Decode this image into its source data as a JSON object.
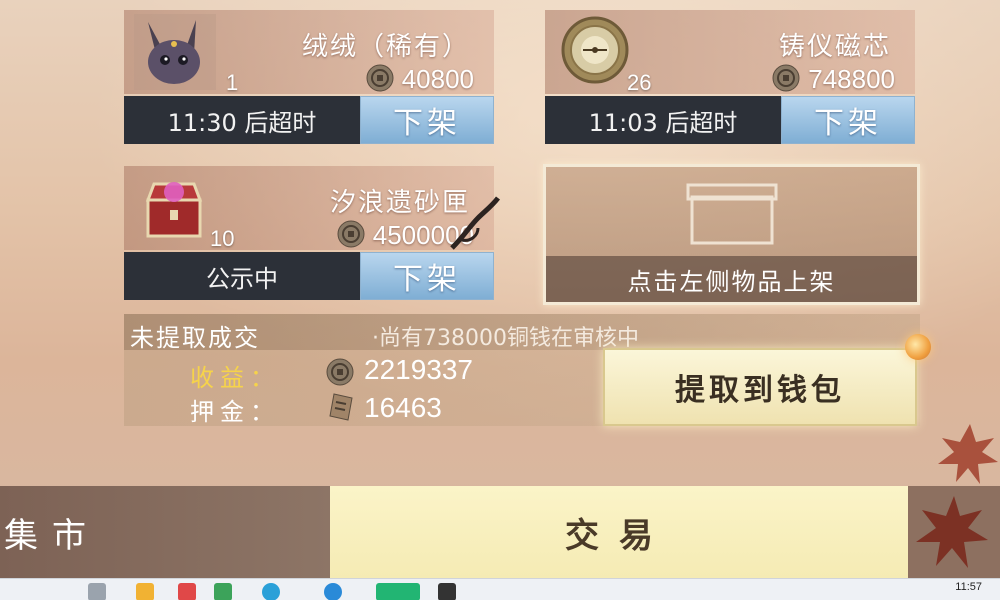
{
  "listings": [
    {
      "name": "绒绒（稀有）",
      "quantity": "1",
      "price": "40800",
      "status": "11:30 后超时",
      "action": "下架",
      "icon": "purple-creature-icon"
    },
    {
      "name": "铸仪磁芯",
      "quantity": "26",
      "price": "748800",
      "status": "11:03 后超时",
      "action": "下架",
      "icon": "compass-core-icon"
    },
    {
      "name": "汐浪遗砂匣",
      "quantity": "10",
      "price": "4500000",
      "status": "公示中",
      "action": "下架",
      "icon": "treasure-chest-icon"
    }
  ],
  "empty_slot": {
    "hint": "点击左侧物品上架",
    "icon": "empty-box-icon"
  },
  "earnings": {
    "title": "未提取成交",
    "notice": "·尚有738000铜钱在审核中",
    "income_label": "收益：",
    "income_value": "2219337",
    "deposit_label": "押金：",
    "deposit_value": "16463",
    "withdraw_label": "提取到钱包"
  },
  "tabs": {
    "market": "集市",
    "trade": "交易"
  },
  "taskbar": {
    "clock": "11:57"
  },
  "colors": {
    "status_bar": "#2c3038",
    "action_button": "#7faed4",
    "income_label": "#f6d34a",
    "deposit_label": "#ffffff",
    "active_tab": "#f5ebb4"
  }
}
